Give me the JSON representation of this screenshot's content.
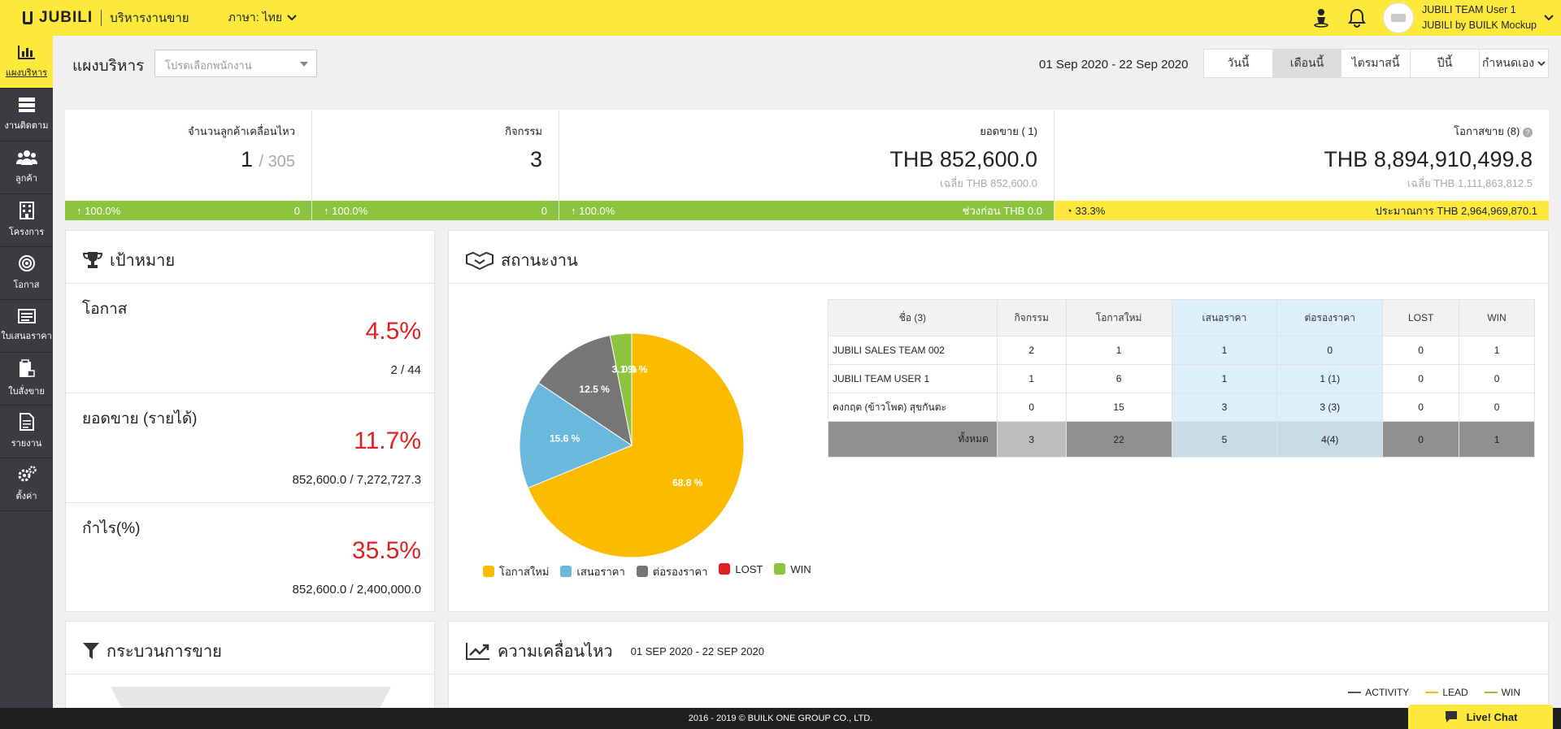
{
  "topbar": {
    "brand": "JUBILI",
    "subtitle": "บริหารงานขาย",
    "language": "ภาษา: ไทย",
    "user_name": "JUBILI TEAM User 1",
    "user_company": "JUBILI by BUILK Mockup"
  },
  "sidebar": {
    "items": [
      {
        "label": "แผงบริหาร",
        "icon": "bar-chart-icon"
      },
      {
        "label": "งานติดตาม",
        "icon": "server-icon"
      },
      {
        "label": "ลูกค้า",
        "icon": "users-icon"
      },
      {
        "label": "โครงการ",
        "icon": "building-icon"
      },
      {
        "label": "โอกาส",
        "icon": "target-icon"
      },
      {
        "label": "ใบเสนอราคา",
        "icon": "list-icon"
      },
      {
        "label": "ใบสั่งขาย",
        "icon": "clipboard-icon"
      },
      {
        "label": "รายงาน",
        "icon": "document-icon"
      },
      {
        "label": "ตั้งค่า",
        "icon": "gears-icon"
      }
    ]
  },
  "header": {
    "title": "แผงบริหาร",
    "employee_placeholder": "โปรดเลือกพนักงาน",
    "date_range": "01 Sep 2020 - 22 Sep 2020",
    "periods": [
      "วันนี้",
      "เดือนนี้",
      "ไตรมาสนี้",
      "ปีนี้",
      "กำหนดเอง"
    ]
  },
  "stats": [
    {
      "label": "จำนวนลูกค้าเคลื่อนไหว",
      "value": "1",
      "total": "/ 305",
      "growth": "100.0%",
      "right": "0"
    },
    {
      "label": "กิจกรรม",
      "value": "3",
      "growth": "100.0%",
      "right": "0"
    },
    {
      "label": "ยอดขาย ( 1)",
      "value": "THB 852,600.0",
      "avg": "เฉลี่ย THB 852,600.0",
      "growth": "100.0%",
      "right": "ช่วงก่อน THB 0.0"
    },
    {
      "label": "โอกาสขาย (8)",
      "value": "THB 8,894,910,499.8",
      "avg": "เฉลี่ย THB 1,111,863,812.5",
      "growth": "33.3%",
      "right": "ประมาณการ THB 2,964,969,870.1"
    }
  ],
  "goals": {
    "title": "เป้าหมาย",
    "rows": [
      {
        "name": "โอกาส",
        "pct": "4.5%",
        "ratio": "2 / 44"
      },
      {
        "name": "ยอดขาย (รายได้)",
        "pct": "11.7%",
        "ratio": "852,600.0 / 7,272,727.3"
      },
      {
        "name": "กำไร(%)",
        "pct": "35.5%",
        "ratio": "852,600.0 / 2,400,000.0"
      }
    ]
  },
  "status": {
    "title": "สถานะงาน",
    "headers": [
      "ชื่อ (3)",
      "กิจกรรม",
      "โอกาสใหม่",
      "เสนอราคา",
      "ต่อรองราคา",
      "LOST",
      "WIN"
    ],
    "rows": [
      [
        "JUBILI SALES TEAM 002",
        "2",
        "1",
        "1",
        "0",
        "0",
        "1"
      ],
      [
        "JUBILI TEAM USER 1",
        "1",
        "6",
        "1",
        "1 (1)",
        "0",
        "0"
      ],
      [
        "คงกฤต (ข้าวโพด) สุขกันตะ",
        "0",
        "15",
        "3",
        "3 (3)",
        "0",
        "0"
      ]
    ],
    "total": [
      "ทั้งหมด",
      "3",
      "22",
      "5",
      "4(4)",
      "0",
      "1"
    ]
  },
  "chart_data": {
    "type": "pie",
    "categories": [
      "โอกาสใหม่",
      "เสนอราคา",
      "ต่อรองราคา",
      "LOST",
      "WIN"
    ],
    "values": [
      68.8,
      15.6,
      12.5,
      0,
      3.1
    ],
    "labels": [
      "68.8 %",
      "15.6 %",
      "12.5 %",
      "",
      "3.1 %"
    ],
    "overlay_label": "0.0 %",
    "colors": [
      "#fdbb00",
      "#6ab9dc",
      "#767676",
      "#e02020",
      "#8cc43f"
    ]
  },
  "process": {
    "title": "กระบวนการขาย"
  },
  "movement": {
    "title": "ความเคลื่อนไหว",
    "date_range": "01 SEP 2020 - 22 SEP 2020",
    "legend": [
      {
        "label": "ACTIVITY",
        "color": "#555555"
      },
      {
        "label": "LEAD",
        "color": "#fdbb00"
      },
      {
        "label": "WIN",
        "color": "#8cc43f"
      }
    ]
  },
  "footer": {
    "copyright": "2016 - 2019 © BUILK ONE GROUP CO., LTD.",
    "livechat": "Live! Chat"
  }
}
